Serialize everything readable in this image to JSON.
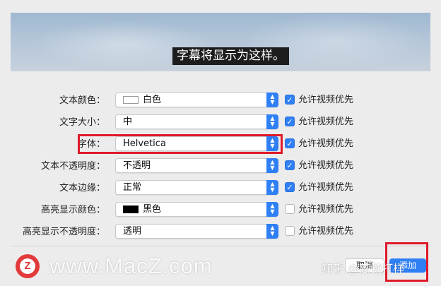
{
  "preview": {
    "caption": "字幕将显示为这样。"
  },
  "rows": [
    {
      "label": "文本颜色：",
      "value": "白色",
      "swatch": "#ffffff",
      "checkbox_label": "允许视频优先",
      "checked": true
    },
    {
      "label": "文字大小：",
      "value": "中",
      "checkbox_label": "允许视频优先",
      "checked": true
    },
    {
      "label": "字体：",
      "value": "Helvetica",
      "checkbox_label": "允许视频优先",
      "checked": true
    },
    {
      "label": "文本不透明度：",
      "value": "不透明",
      "checkbox_label": "允许视频优先",
      "checked": true
    },
    {
      "label": "文本边缘：",
      "value": "正常",
      "checkbox_label": "允许视频优先",
      "checked": true
    },
    {
      "label": "高亮显示颜色：",
      "value": "黑色",
      "swatch": "#000000",
      "checkbox_label": "允许视频优先",
      "checked": false
    },
    {
      "label": "高亮显示不透明度：",
      "value": "透明",
      "checkbox_label": "允许视频优先",
      "checked": false
    }
  ],
  "buttons": {
    "cancel": "取消",
    "add": "添加"
  },
  "watermark": {
    "site": "www.MacZ.com",
    "logo_letter": "Z",
    "zhihu": "知乎 @高顿打样"
  },
  "colors": {
    "accent": "#2f7ff5",
    "highlight": "#e01a2a"
  }
}
